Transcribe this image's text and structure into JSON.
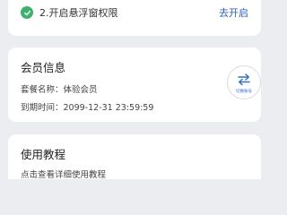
{
  "permission_card": {
    "item_label": "2.开启悬浮窗权限",
    "action_label": "去开启",
    "status_icon": "check-icon",
    "status_color": "#3bb36a",
    "action_color": "#2a5fce"
  },
  "member_card": {
    "title": "会员信息",
    "plan_line": "套餐名称：体验会员",
    "expiry_line": "到期时间：2099-12-31 23:59:59",
    "switch_icon": "swap-arrows-icon",
    "switch_caption": "切换账号",
    "accent_color": "#2f6fe0"
  },
  "tutorial_card": {
    "title": "使用教程",
    "subtitle": "点击查看详细使用教程"
  }
}
